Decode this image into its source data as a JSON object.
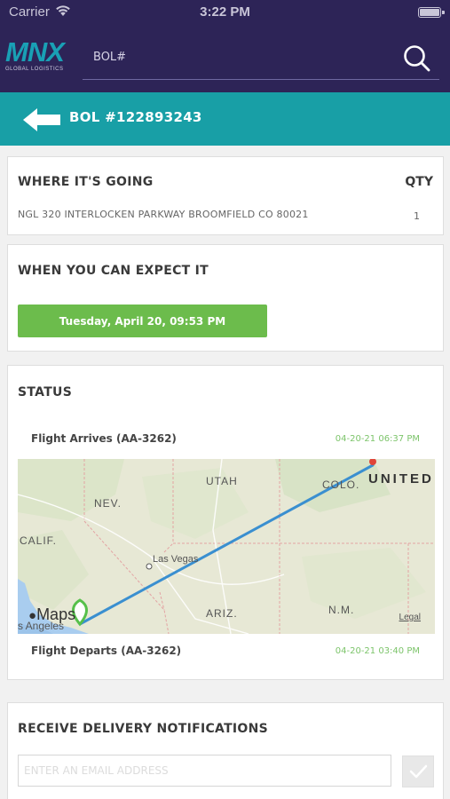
{
  "status_bar": {
    "carrier": "Carrier",
    "time": "3:22 PM",
    "icons": [
      "wifi-icon",
      "battery-icon"
    ]
  },
  "header": {
    "logo_text": "MNX",
    "logo_subtitle": "GLOBAL LOGISTICS",
    "search_placeholder": "BOL#",
    "search_value": "",
    "icons": [
      "search-icon"
    ],
    "colors": {
      "background": "#2d2457",
      "accent": "#19a0b5"
    }
  },
  "subheader": {
    "title": "BOL #122893243",
    "icons": [
      "back-arrow-icon"
    ],
    "color": "#189fa6"
  },
  "destination": {
    "title": "WHERE IT'S GOING",
    "qty_label": "QTY",
    "address": "NGL 320 INTERLOCKEN PARKWAY BROOMFIELD CO 80021",
    "qty": "1"
  },
  "expect": {
    "title": "WHEN YOU CAN EXPECT IT",
    "eta": "Tuesday, April 20, 09:53 PM",
    "color": "#6cbc4c"
  },
  "status": {
    "title": "STATUS",
    "events": [
      {
        "label": "Flight Arrives (AA-3262)",
        "time": "04-20-21 06:37 PM"
      },
      {
        "label": "Flight Departs (AA-3262)",
        "time": "04-20-21 03:40 PM"
      }
    ],
    "map": {
      "labels": {
        "utah": "UTAH",
        "colo": "COLO.",
        "united": "UNITED",
        "nev": "NEV.",
        "calif": "CALIF.",
        "las_vegas": "Las Vegas",
        "ariz": "ARIZ.",
        "nm": "N.M.",
        "los_angeles": "s Angeles"
      },
      "badge": "Maps",
      "legal": "Legal",
      "route_color": "#3a8fd0",
      "icons": [
        "apple-logo-icon",
        "origin-pin-icon",
        "destination-pin-icon"
      ]
    }
  },
  "notify": {
    "title": "RECEIVE DELIVERY NOTIFICATIONS",
    "email_placeholder": "ENTER AN EMAIL ADDRESS",
    "email_value": "",
    "icons": [
      "checkmark-icon"
    ]
  }
}
